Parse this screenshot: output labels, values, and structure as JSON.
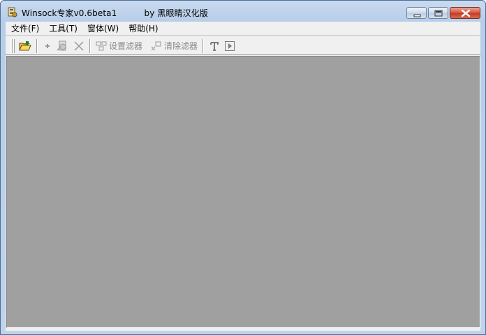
{
  "window": {
    "title": "Winsock专家v0.6beta1",
    "subtitle": "by 黑眼睛汉化版"
  },
  "menu": {
    "items": [
      {
        "label": "文件(F)"
      },
      {
        "label": "工具(T)"
      },
      {
        "label": "窗体(W)"
      },
      {
        "label": "帮助(H)"
      }
    ]
  },
  "toolbar": {
    "set_filter_label": "设置滤器",
    "clear_filter_label": "清除滤器"
  },
  "colors": {
    "workspace": "#a0a0a0",
    "titlebar": "#bfd3ec",
    "close_button": "#c8442e"
  }
}
